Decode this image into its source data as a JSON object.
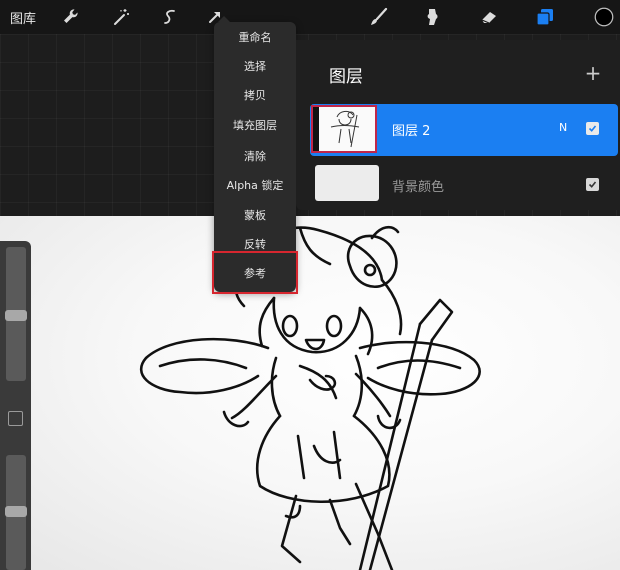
{
  "toolbar": {
    "gallery_label": "图库",
    "left_icons": [
      "wrench-icon",
      "magic-wand-icon",
      "selection-icon",
      "transform-arrow-icon"
    ],
    "right_icons": [
      "brush-icon",
      "smudge-icon",
      "eraser-icon",
      "layers-icon",
      "color-circle-icon"
    ],
    "accent_color": "#1b7ff2",
    "color_swatch": "#000000"
  },
  "layer_menu": {
    "items": [
      {
        "label": "重命名"
      },
      {
        "label": "选择"
      },
      {
        "label": "拷贝"
      },
      {
        "label": "填充图层"
      },
      {
        "label": "清除"
      },
      {
        "label": "Alpha 锁定"
      },
      {
        "label": "蒙板"
      },
      {
        "label": "反转"
      },
      {
        "label": "参考"
      }
    ],
    "highlighted_item": "参考",
    "highlight_color": "#d6262f"
  },
  "layers_panel": {
    "title": "图层",
    "add_label": "+",
    "layers": [
      {
        "name": "图层 2",
        "blend_mode": "N",
        "visible": true,
        "selected": true
      },
      {
        "name": "背景颜色",
        "visible": true,
        "selected": false
      }
    ]
  },
  "sidebar": {
    "brush_size_level": 0.62,
    "opacity_level": 0.45
  }
}
